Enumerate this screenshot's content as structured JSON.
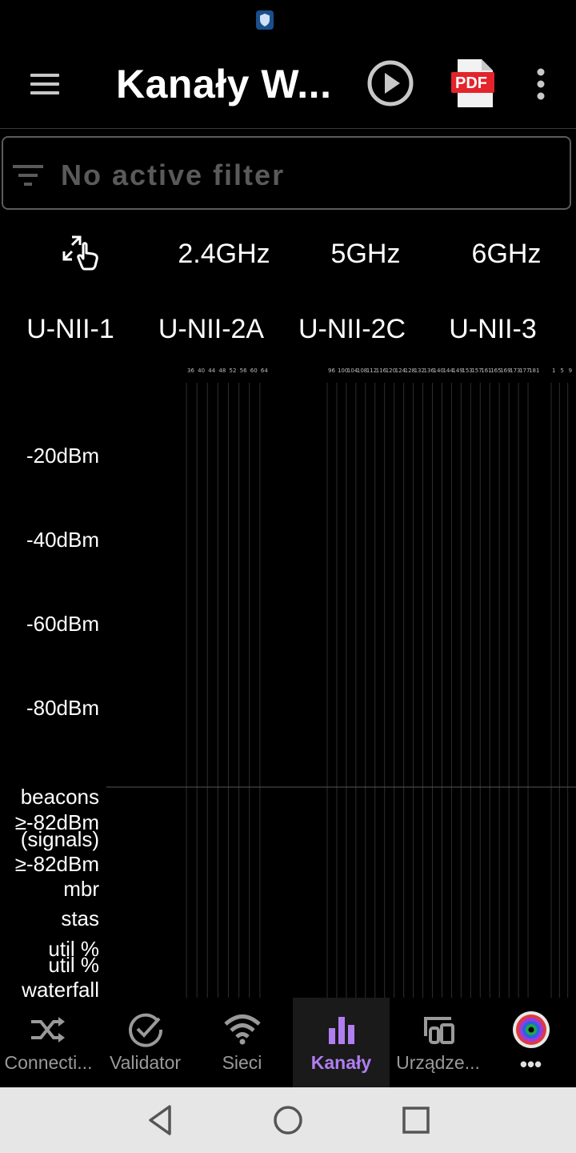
{
  "app_bar": {
    "title": "Kanały W...",
    "pdf_label": "PDF"
  },
  "filter": {
    "placeholder": "No active filter"
  },
  "bands": [
    "2.4GHz",
    "5GHz",
    "6GHz"
  ],
  "unii": [
    "U-NII-1",
    "U-NII-2A",
    "U-NII-2C",
    "U-NII-3"
  ],
  "chart_data": {
    "type": "bar",
    "y_axis_labels": [
      "-20dBm",
      "-40dBm",
      "-60dBm",
      "-80dBm"
    ],
    "metric_labels": [
      "beacons",
      "≥-82dBm",
      "(signals)",
      "≥-82dBm",
      "mbr",
      "stas",
      "util %",
      "util %",
      "waterfall"
    ],
    "channel_groups": [
      {
        "name": "U-NII-1 / U-NII-2A",
        "channels": [
          "36",
          "40",
          "44",
          "48",
          "52",
          "56",
          "60",
          "64"
        ]
      },
      {
        "name": "U-NII-2C / U-NII-3",
        "channels": [
          "96",
          "100",
          "104",
          "108",
          "112",
          "116",
          "120",
          "124",
          "128",
          "132",
          "136",
          "140",
          "144",
          "149",
          "153",
          "157",
          "161",
          "165",
          "169",
          "173",
          "177",
          "181"
        ]
      },
      {
        "name": "6GHz",
        "channels": [
          "1",
          "5",
          "9"
        ]
      }
    ],
    "series": [],
    "grid": true
  },
  "bottom_nav": [
    {
      "label": "Connecti...",
      "icon": "shuffle-icon",
      "active": false
    },
    {
      "label": "Validator",
      "icon": "check-circle-icon",
      "active": false
    },
    {
      "label": "Sieci",
      "icon": "wifi-icon",
      "active": false
    },
    {
      "label": "Kanały",
      "icon": "bar-chart-icon",
      "active": true
    },
    {
      "label": "Urządze...",
      "icon": "devices-icon",
      "active": false
    },
    {
      "label": "•••",
      "icon": "more-apps-icon",
      "active": false
    }
  ],
  "colors": {
    "accent": "#b07ef0",
    "background": "#000000",
    "pdf_red": "#e3242b",
    "system_nav": "#e6e6e6"
  }
}
